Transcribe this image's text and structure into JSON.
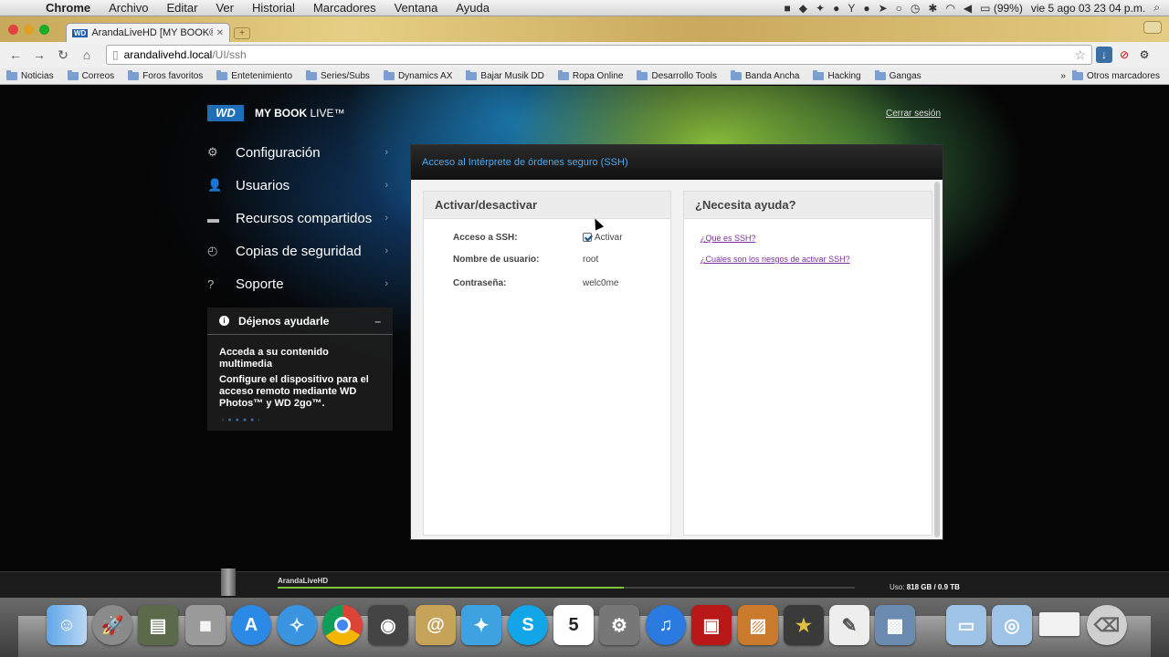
{
  "menubar": {
    "app": "Chrome",
    "items": [
      "Archivo",
      "Editar",
      "Ver",
      "Historial",
      "Marcadores",
      "Ventana",
      "Ayuda"
    ],
    "battery": "(99%)",
    "clock": "vie 5 ago  03 23 04 p.m."
  },
  "tab": {
    "favicon": "WD",
    "title": "ArandaLiveHD [MY BOOK® L"
  },
  "address": {
    "host": "arandalivehd.local",
    "path": "/UI/ssh"
  },
  "bookmarks": [
    "Noticias",
    "Correos",
    "Foros favoritos",
    "Entetenimiento",
    "Series/Subs",
    "Dynamics AX",
    "Bajar Musik DD",
    "Ropa Online",
    "Desarrollo Tools",
    "Banda Ancha",
    "Hacking",
    "Gangas"
  ],
  "bookmarks_other": "Otros marcadores",
  "header": {
    "logo": "WD",
    "product": "MY BOOK",
    "product_suffix": "LIVE™",
    "logout": "Cerrar sesión"
  },
  "nav": [
    {
      "label": "Configuración",
      "icon": "gear-icon"
    },
    {
      "label": "Usuarios",
      "icon": "users-icon"
    },
    {
      "label": "Recursos compartidos",
      "icon": "folder-icon"
    },
    {
      "label": "Copias de seguridad",
      "icon": "backup-icon"
    },
    {
      "label": "Soporte",
      "icon": "help-icon"
    }
  ],
  "helpbox": {
    "title": "Déjenos ayudarle",
    "line1": "Acceda a su contenido multimedia",
    "line2": "Configure el dispositivo para el acceso remoto mediante WD Photos™ y WD 2go™."
  },
  "panel": {
    "title": "Acceso al Intérprete de órdenes seguro (SSH)",
    "toggle_card": {
      "title": "Activar/desactivar",
      "ssh_label": "Acceso a SSH:",
      "ssh_value": "Activar",
      "ssh_checked": true,
      "user_label": "Nombre de usuario:",
      "user_value": "root",
      "pass_label": "Contraseña:",
      "pass_value": "welc0me"
    },
    "help_card": {
      "title": "¿Necesita ayuda?",
      "link1": "¿Qué es SSH?",
      "link2": "¿Cuáles son los riesgos de activar SSH?"
    }
  },
  "footer": {
    "device": "ArandaLiveHD",
    "usage_label": "Uso:",
    "usage_value": "818 GB / 0.9 TB",
    "usage_fraction": 0.6
  },
  "dock": [
    "finder-icon",
    "launchpad-icon",
    "utility-icon",
    "calculator-icon",
    "appstore-icon",
    "safari-icon",
    "chrome-icon",
    "facetime-icon",
    "contacts-icon",
    "twitter-icon",
    "skype-icon",
    "calendar-icon",
    "system-preferences-icon",
    "itunes-icon",
    "photo-booth-icon",
    "iphoto-icon",
    "imovie-icon",
    "textedit-icon",
    "preview-icon",
    "applications-folder-icon",
    "downloads-folder-icon",
    "documents-stack-icon",
    "trash-icon"
  ],
  "dock_calendar_day": "5",
  "colors": {
    "accent": "#4aa9ee",
    "wd_blue": "#1f6fb8",
    "link": "#7b2e9a",
    "progress": "#7cc43a"
  }
}
